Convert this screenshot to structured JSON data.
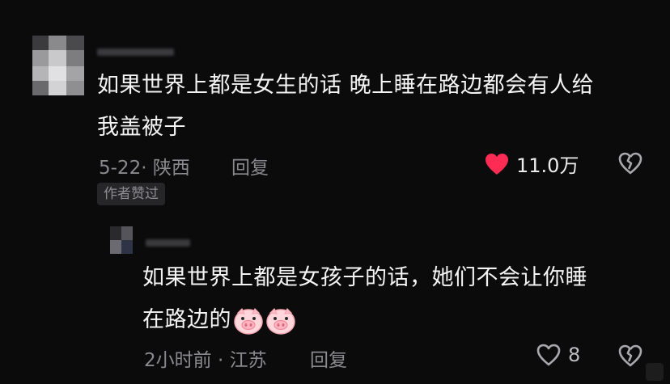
{
  "comment": {
    "text_line1": "如果世界上都是女生的话 晚上睡在路边都会有人给",
    "text_line2": "我盖被子",
    "date_location": "5-22· 陕西",
    "reply_label": "回复",
    "like_count": "11.0万",
    "author_liked_badge": "作者赞过",
    "like_color": "#fe2c55"
  },
  "reply": {
    "text_line1": "如果世界上都是女孩子的话，她们不会让你睡",
    "text_line2": "在路边的",
    "emoji": [
      "pig-face-emoji",
      "pig-face-emoji"
    ],
    "date_location": "2小时前 · 江苏",
    "reply_label": "回复",
    "like_count": "8"
  },
  "icons": {
    "like_filled": "heart-filled-icon",
    "like_outline": "heart-outline-icon",
    "dislike": "broken-heart-icon"
  }
}
